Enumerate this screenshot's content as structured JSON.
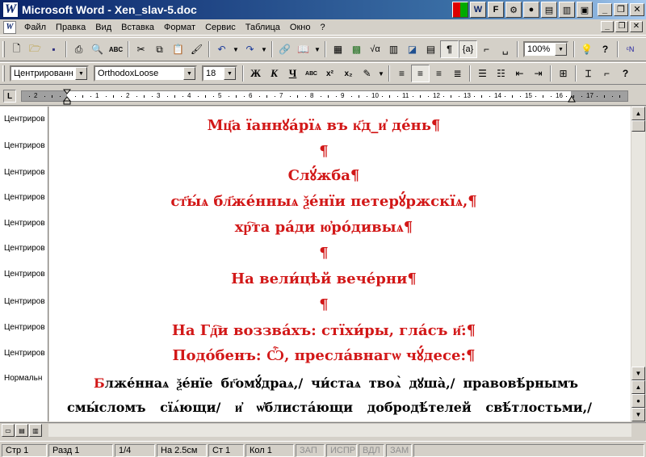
{
  "window": {
    "title": "Microsoft Word - Xen_slav-5.doc",
    "app_icon": "W",
    "right_icons": [
      "word-icon",
      "font-icon",
      "settings-icon",
      "disk-icon",
      "page-icon",
      "book-icon",
      "window-icon"
    ]
  },
  "menu": [
    "Файл",
    "Правка",
    "Вид",
    "Вставка",
    "Формат",
    "Сервис",
    "Таблица",
    "Окно",
    "?"
  ],
  "toolbar_standard": {
    "zoom": "100%",
    "formula_label": "{a}"
  },
  "toolbar_format": {
    "style": "Центрированн",
    "font": "OrthodoxLoose",
    "size": "18",
    "bold": "Ж",
    "italic": "К",
    "underline": "Ч",
    "smallcaps": "АВС"
  },
  "ruler": {
    "numbers": [
      "1",
      "2",
      "1",
      "2",
      "3",
      "4",
      "5",
      "6",
      "7",
      "8",
      "9",
      "10",
      "11",
      "12",
      "13",
      "14",
      "15",
      "16",
      "17"
    ]
  },
  "style_column": [
    "Центриров",
    "Центриров",
    "Центриров",
    "Центриров",
    "Центриров",
    "Центриров",
    "Центриров",
    "Центриров",
    "Центриров",
    "Центриров",
    "Нормальн"
  ],
  "document": {
    "paragraphs": [
      "Мц҃а їаннꙋа́рїѧ въ к҃д_и҆ де́нь¶",
      "¶",
      "Слꙋ́жба¶",
      "ст҃ы́ѧ бл҃же́нныѧ ѯе́нїи петерꙋ́ржскїѧ,¶",
      "хр҇та ра́ди ю҆ро́дивыѧ¶",
      "¶",
      "На вели́цѣй вече́рни¶",
      "¶",
      "На Гд҇и воззва́хъ: стїхи́ры, гла́съ и҃:¶",
      "Подо́бенъ: Ѽ, пресла́внагѡ чꙋ́десе:¶"
    ],
    "body_initial": "Б",
    "body_lines": [
      "лже́ннаѧ ѯе́нїе бг҃омꙋ́драѧ,/ чи́стаѧ твоѧ̀ дꙋша̀,/ правовѣ́рнымъ",
      "смы́сломъ сїѧ́ющи/ и҆ ѡ҆блиста́ющи добродѣ́телей свѣ́тлостьми,/"
    ]
  },
  "statusbar": {
    "page": "Стр 1",
    "section": "Разд 1",
    "pages": "1/4",
    "at": "На 2.5см",
    "line": "Ст 1",
    "col": "Кол 1",
    "rec": "ЗАП",
    "trk": "ИСПР",
    "ext": "ВДЛ",
    "ovr": "ЗАМ"
  }
}
